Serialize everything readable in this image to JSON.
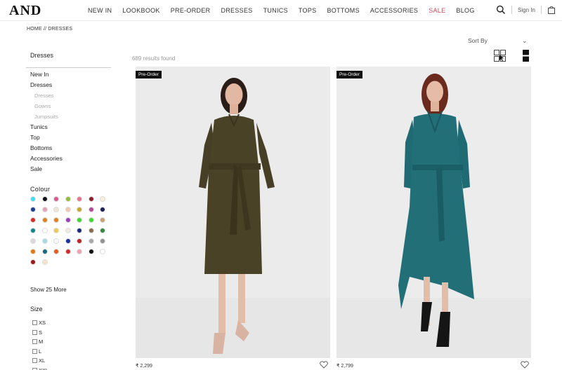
{
  "brand": {
    "logo": "AND"
  },
  "nav": {
    "items": [
      "NEW IN",
      "LOOKBOOK",
      "PRE-ORDER",
      "DRESSES",
      "TUNICS",
      "TOPS",
      "BOTTOMS",
      "ACCESSORIES"
    ],
    "sale": "SALE",
    "blog": "BLOG"
  },
  "header": {
    "signin": "Sign In",
    "icons": [
      "search-icon",
      "shopping-bag-icon"
    ]
  },
  "breadcrumb": "HOME // DRESSES",
  "sidebar": {
    "heading": "Dresses",
    "categories": [
      {
        "label": "New In",
        "sub": false
      },
      {
        "label": "Dresses",
        "sub": false
      },
      {
        "label": "Dresses",
        "sub": true
      },
      {
        "label": "Gowns",
        "sub": true
      },
      {
        "label": "Jumpsuits",
        "sub": true
      },
      {
        "label": "Tunics",
        "sub": false
      },
      {
        "label": "Top",
        "sub": false
      },
      {
        "label": "Bottoms",
        "sub": false
      },
      {
        "label": "Accessories",
        "sub": false
      },
      {
        "label": "Sale",
        "sub": false
      }
    ],
    "colour_title": "Colour",
    "colours": [
      "#40e0f0",
      "#111111",
      "#d85a8e",
      "#8fbf3a",
      "#e8728a",
      "#8b1e2a",
      "#f5f0d6",
      "#1c3f8f",
      "#e8a0b4",
      "#efe7d2",
      "#f4c7b0",
      "#c9a52e",
      "#b04a9a",
      "#1a1f5a",
      "#d62d2d",
      "#e0811f",
      "#e0811f",
      "#9a3fc0",
      "#3dd82f",
      "#3dd82f",
      "#c8a070",
      "#12858c",
      "#ffffff",
      "#f0c850",
      "#f2e8e0",
      "#1a2a80",
      "#8a6a4a",
      "#2e8a3a",
      "#d8d8d8",
      "#a8dce0",
      "#ffffff",
      "#1a2fa0",
      "#c02020",
      "#a8a8a8",
      "#909090",
      "#e07a10",
      "#186a7a",
      "#e85a20",
      "#d02a2a",
      "#f0a0b0",
      "#111111",
      "#ffffff",
      "#9a1a1a",
      "#f5e6c8"
    ],
    "show_more": "Show 25 More",
    "size_title": "Size",
    "sizes": [
      "XS",
      "S",
      "M",
      "L",
      "XL",
      "XXL"
    ]
  },
  "toolbar": {
    "results": "689 results found",
    "sort": "Sort By"
  },
  "products": [
    {
      "badge": "Pre-Order",
      "price": "₹ 2,299"
    },
    {
      "badge": "Pre-Order",
      "price": "₹ 2,799"
    }
  ]
}
